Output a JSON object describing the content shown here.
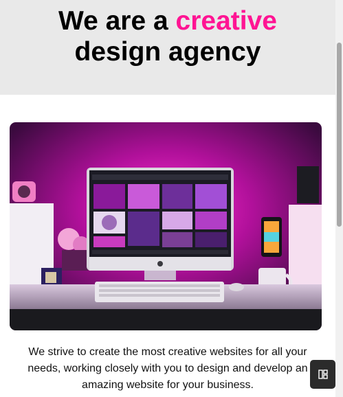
{
  "hero": {
    "title_line1_prefix": "We are a ",
    "title_line1_accent": "creative",
    "title_line2": "design agency"
  },
  "description": "We strive to create the most creative websites for all your needs, working closely with you to design and develop an amazing website for your business.",
  "icons": {
    "widget": "layout-grid-icon"
  },
  "colors": {
    "accent": "#ff1493",
    "hero_background": "#e9e9e9",
    "widget_button": "#2b2b2b"
  }
}
